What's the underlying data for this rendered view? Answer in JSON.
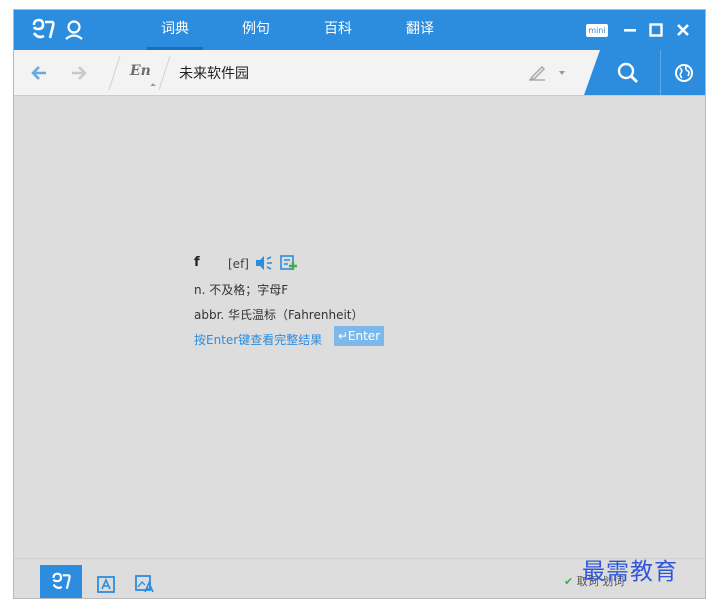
{
  "titlebar": {
    "tabs": [
      {
        "label": "词典",
        "active": true
      },
      {
        "label": "例句",
        "active": false
      },
      {
        "label": "百科",
        "active": false
      },
      {
        "label": "翻译",
        "active": false
      }
    ],
    "mini_label": "mini",
    "accent_color": "#2c8ddf"
  },
  "toolbar": {
    "lang_label": "En",
    "search_value": "未来软件园"
  },
  "result": {
    "word": "f",
    "phonetic": "[ef]",
    "definitions": [
      "n. 不及格；字母F",
      "abbr. 华氏温标（Fahrenheit）"
    ],
    "enter_hint": "按Enter键查看完整结果",
    "enter_badge": "↵Enter"
  },
  "statusbar": {
    "text": "取词 划词"
  },
  "watermark": "最需教育"
}
